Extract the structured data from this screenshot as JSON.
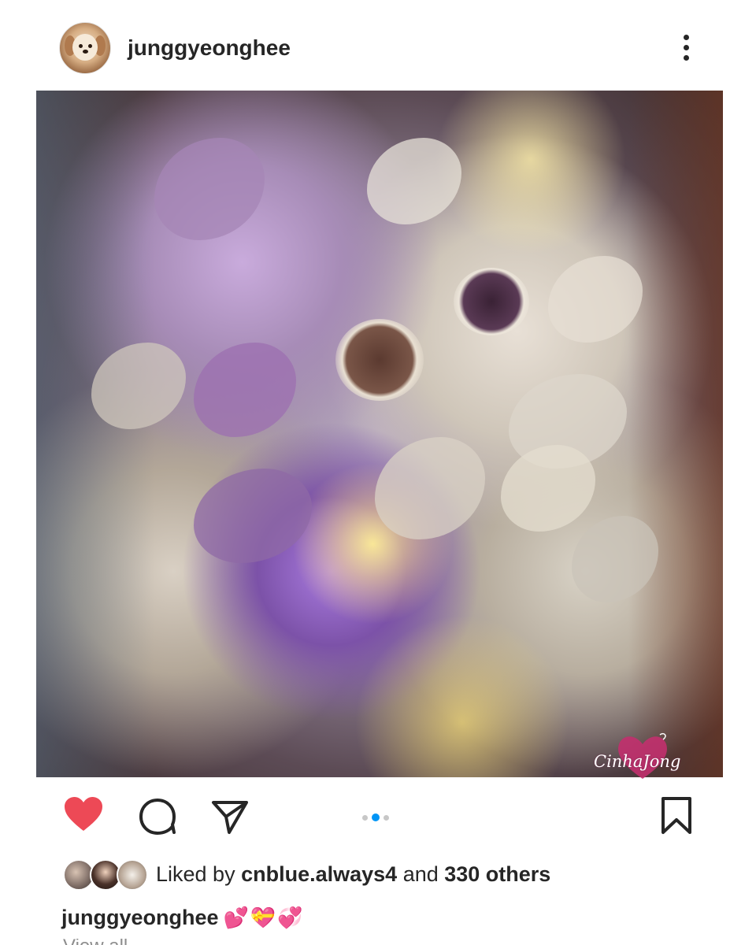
{
  "header": {
    "username": "junggyeonghee",
    "avatar_icon": "dog-avatar",
    "more_icon": "more-vertical-icon"
  },
  "post": {
    "image_description_icon": "flower-photo",
    "watermark_text": "CinhaJong"
  },
  "actions": {
    "like_icon": "heart-icon",
    "like_color": "#ed4956",
    "comment_icon": "comment-icon",
    "share_icon": "send-icon",
    "save_icon": "bookmark-icon",
    "carousel": {
      "count": 3,
      "active_index": 1,
      "active_color": "#0095f6"
    }
  },
  "likes": {
    "prefix": "Liked by ",
    "user": "cnblue.always4",
    "middle": " and ",
    "others": "330 others"
  },
  "caption": {
    "username": "junggyeonghee",
    "text": "💕💝💞"
  },
  "comments": {
    "more_label": "View all"
  }
}
